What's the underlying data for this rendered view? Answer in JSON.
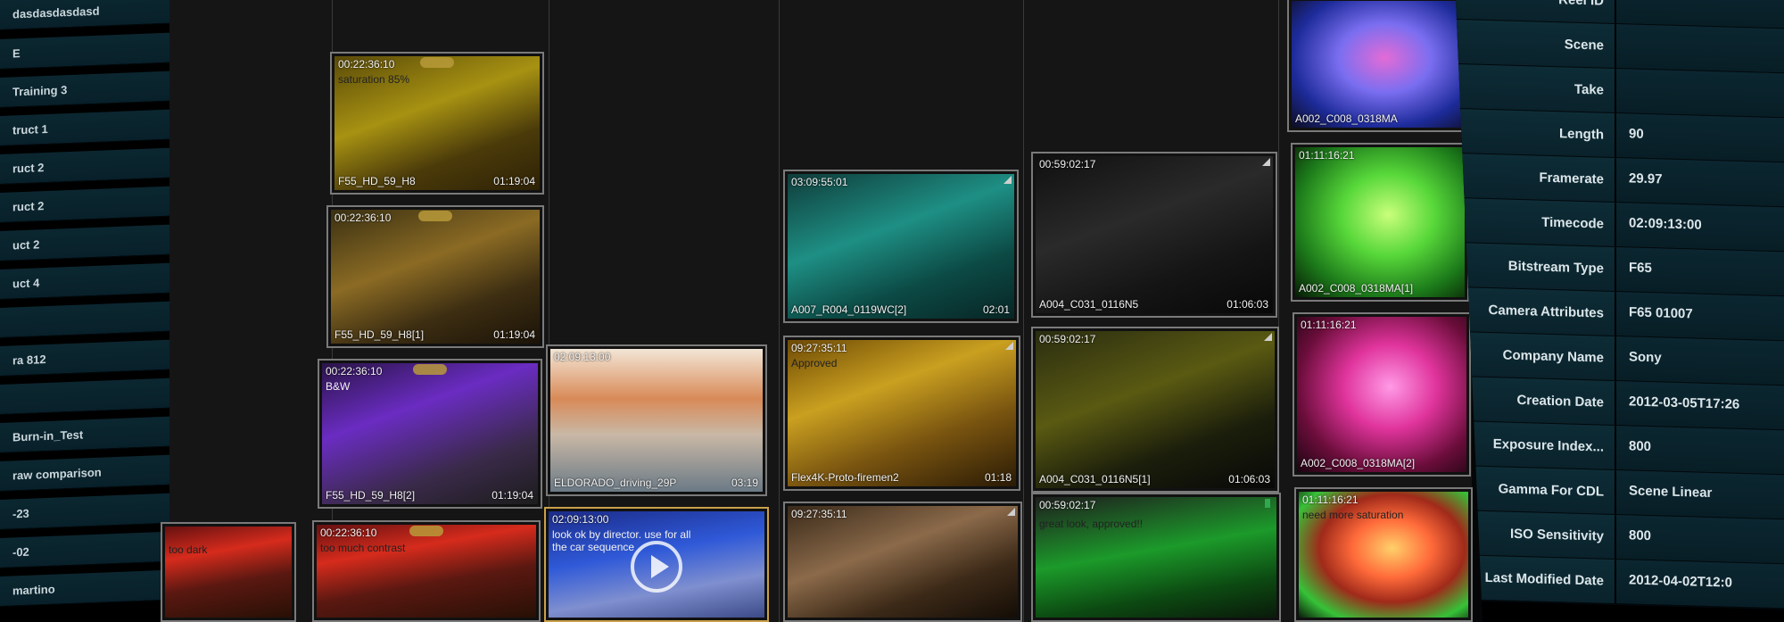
{
  "sidebar": {
    "items": [
      "dasdasdasdasd",
      "E",
      "Training 3",
      "truct 1",
      "ruct 2",
      "ruct 2",
      "uct 2",
      "uct 4",
      "",
      "ra 812",
      "",
      "Burn-in_Test",
      "raw comparison",
      "-23",
      "-02",
      "martino"
    ]
  },
  "grid": {
    "clips": [
      {
        "timecode": "00:22:36:10",
        "note": "saturation 85%",
        "name": "F55_HD_59_H8",
        "duration": "01:19:04",
        "look": "yellow"
      },
      {
        "timecode": "00:22:36:10",
        "note": "",
        "name": "F55_HD_59_H8[1]",
        "duration": "01:19:04",
        "look": "yellow2"
      },
      {
        "timecode": "00:22:36:10",
        "note": "B&W",
        "name": "F55_HD_59_H8[2]",
        "duration": "01:19:04",
        "look": "purple"
      },
      {
        "timecode": "00:22:36:10",
        "note": "too much contrast",
        "name": "",
        "duration": "",
        "look": "red"
      },
      {
        "timecode": "",
        "note": "too dark",
        "name": "",
        "duration": "",
        "look": "red"
      },
      {
        "timecode": "02:09:13:00",
        "note": "",
        "name": "ELDORADO_driving_29P",
        "duration": "03:19",
        "look": "desert"
      },
      {
        "timecode": "02:09:13:00",
        "note": "look ok by director. use for all the car sequence",
        "name": "",
        "duration": "",
        "look": "blue"
      },
      {
        "timecode": "03:09:55:01",
        "note": "",
        "name": "A007_R004_0119WC[2]",
        "duration": "02:01",
        "look": "teal"
      },
      {
        "timecode": "09:27:35:11",
        "note": "Approved",
        "name": "Flex4K-Proto-firemen2",
        "duration": "01:18",
        "look": "fire"
      },
      {
        "timecode": "09:27:35:11",
        "note": "",
        "name": "",
        "duration": "",
        "look": "fireman"
      },
      {
        "timecode": "00:59:02:17",
        "note": "",
        "name": "A004_C031_0116N5",
        "duration": "01:06:03",
        "look": "dark"
      },
      {
        "timecode": "00:59:02:17",
        "note": "",
        "name": "A004_C031_0116N5[1]",
        "duration": "01:06:03",
        "look": "darkgreen"
      },
      {
        "timecode": "00:59:02:17",
        "note": "great look, approved!!",
        "name": "",
        "duration": "",
        "look": "green"
      },
      {
        "timecode": "",
        "note": "",
        "name": "A002_C008_0318MA",
        "duration": "",
        "look": "orchid-blue"
      },
      {
        "timecode": "01:11:16:21",
        "note": "",
        "name": "A002_C008_0318MA[1]",
        "duration": "",
        "look": "orchid-green"
      },
      {
        "timecode": "01:11:16:21",
        "note": "",
        "name": "A002_C008_0318MA[2]",
        "duration": "",
        "look": "orchid-pink"
      },
      {
        "timecode": "01:11:16:21",
        "note": "need more saturation",
        "name": "",
        "duration": "",
        "look": "orchid-warm"
      }
    ]
  },
  "metadata": {
    "rows": [
      {
        "label": "Reel ID",
        "value": ""
      },
      {
        "label": "Scene",
        "value": ""
      },
      {
        "label": "Take",
        "value": ""
      },
      {
        "label": "Length",
        "value": "90"
      },
      {
        "label": "Framerate",
        "value": "29.97"
      },
      {
        "label": "Timecode",
        "value": "02:09:13:00"
      },
      {
        "label": "Bitstream Type",
        "value": "F65"
      },
      {
        "label": "Camera Attributes",
        "value": "F65 01007"
      },
      {
        "label": "Company Name",
        "value": "Sony"
      },
      {
        "label": "Creation Date",
        "value": "2012-03-05T17:26"
      },
      {
        "label": "Exposure Index...",
        "value": "800"
      },
      {
        "label": "Gamma For CDL",
        "value": "Scene Linear"
      },
      {
        "label": "ISO Sensitivity",
        "value": "800"
      },
      {
        "label": "Last Modified Date",
        "value": "2012-04-02T12:0"
      }
    ]
  }
}
